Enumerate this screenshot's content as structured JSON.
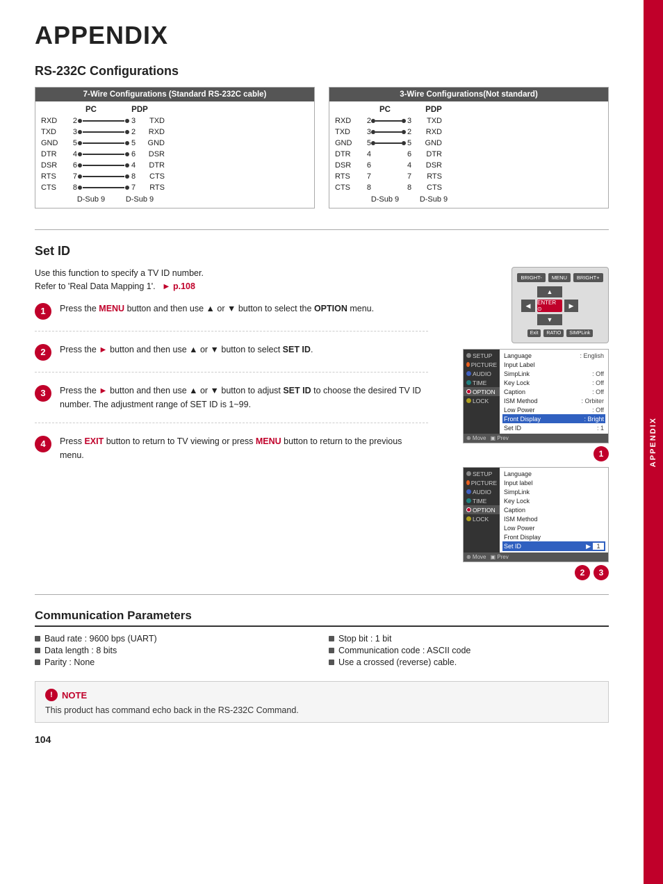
{
  "page": {
    "title": "APPENDIX",
    "number": "104",
    "sidebar_label": "APPENDIX"
  },
  "rs232c": {
    "heading": "RS-232C Configurations",
    "seven_wire": {
      "header": "7-Wire Configurations (Standard RS-232C cable)",
      "pc_label": "PC",
      "pdp_label": "PDP",
      "rows": [
        {
          "left": "RXD",
          "pc": "2",
          "pdp": "3",
          "right": "TXD",
          "connected": true
        },
        {
          "left": "TXD",
          "pc": "3",
          "pdp": "2",
          "right": "RXD",
          "connected": true
        },
        {
          "left": "GND",
          "pc": "5",
          "pdp": "5",
          "right": "GND",
          "connected": true
        },
        {
          "left": "DTR",
          "pc": "4",
          "pdp": "6",
          "right": "DSR",
          "connected": true
        },
        {
          "left": "DSR",
          "pc": "6",
          "pdp": "4",
          "right": "DTR",
          "connected": true
        },
        {
          "left": "RTS",
          "pc": "7",
          "pdp": "8",
          "right": "CTS",
          "connected": true
        },
        {
          "left": "CTS",
          "pc": "8",
          "pdp": "7",
          "right": "RTS",
          "connected": true
        }
      ],
      "dsub_pc": "D-Sub 9",
      "dsub_pdp": "D-Sub 9"
    },
    "three_wire": {
      "header": "3-Wire Configurations(Not standard)",
      "pc_label": "PC",
      "pdp_label": "PDP",
      "rows": [
        {
          "left": "RXD",
          "pc": "2",
          "pdp": "3",
          "right": "TXD",
          "connected": true
        },
        {
          "left": "TXD",
          "pc": "3",
          "pdp": "2",
          "right": "RXD",
          "connected": true
        },
        {
          "left": "GND",
          "pc": "5",
          "pdp": "5",
          "right": "GND",
          "connected": true
        },
        {
          "left": "DTR",
          "pc": "4",
          "pdp": "6",
          "right": "DTR",
          "connected": false
        },
        {
          "left": "DSR",
          "pc": "6",
          "pdp": "4",
          "right": "DSR",
          "connected": false
        },
        {
          "left": "RTS",
          "pc": "7",
          "pdp": "7",
          "right": "RTS",
          "connected": false
        },
        {
          "left": "CTS",
          "pc": "8",
          "pdp": "8",
          "right": "CTS",
          "connected": false
        }
      ],
      "dsub_pc": "D-Sub 9",
      "dsub_pdp": "D-Sub 9"
    }
  },
  "set_id": {
    "heading": "Set ID",
    "intro1": "Use this function to specify a TV ID number.",
    "intro2": "Refer to 'Real Data Mapping 1'.",
    "page_ref": "p.108",
    "steps": [
      {
        "num": "1",
        "text_parts": [
          "Press the ",
          "MENU",
          " button and then use ▲ or ▼ button to select the ",
          "OPTION",
          " menu."
        ]
      },
      {
        "num": "2",
        "text_parts": [
          "Press the ",
          "▶",
          " button and then use ▲ or ▼ button to select ",
          "SET ID",
          "."
        ]
      },
      {
        "num": "3",
        "text_parts": [
          "Press the ",
          "▶",
          " button and then use ▲ or ▼ button to adjust ",
          "SET ID",
          " to choose the desired TV ID number. The adjustment range of SET ID is 1~99."
        ]
      },
      {
        "num": "4",
        "text_parts": [
          "Press ",
          "EXIT",
          " button to return to TV viewing or press ",
          "MENU",
          " button to return to the previous menu."
        ]
      }
    ],
    "menu1": {
      "sidebar_items": [
        "SETUP",
        "PICTURE",
        "AUDIO",
        "TIME",
        "OPTION",
        "LOCK"
      ],
      "active_item": "OPTION",
      "rows": [
        {
          "label": "Language",
          "value": ": English"
        },
        {
          "label": "Input Label",
          "value": ""
        },
        {
          "label": "SimpLink",
          "value": ": Off"
        },
        {
          "label": "Key Lock",
          "value": ": Off"
        },
        {
          "label": "Caption",
          "value": ": Off"
        },
        {
          "label": "ISM Method",
          "value": ": Orbiter"
        },
        {
          "label": "Low Power",
          "value": ": Off"
        },
        {
          "label": "Front Display",
          "value": ": Bright"
        },
        {
          "label": "Set ID",
          "value": ": 1"
        }
      ],
      "footer": "Move  Prev"
    },
    "menu2": {
      "sidebar_items": [
        "SETUP",
        "PICTURE",
        "AUDIO",
        "TIME",
        "OPTION",
        "LOCK"
      ],
      "active_item": "OPTION",
      "rows": [
        {
          "label": "Language",
          "value": ""
        },
        {
          "label": "Input label",
          "value": ""
        },
        {
          "label": "SimpLink",
          "value": ""
        },
        {
          "label": "Key Lock",
          "value": ""
        },
        {
          "label": "Caption",
          "value": ""
        },
        {
          "label": "ISM Method",
          "value": ""
        },
        {
          "label": "Low Power",
          "value": ""
        },
        {
          "label": "Front Display",
          "value": ""
        },
        {
          "label": "Set ID",
          "value": "▶",
          "has_box": true
        }
      ],
      "footer": "Move  Prev",
      "badge": "1"
    }
  },
  "comm_params": {
    "heading": "Communication Parameters",
    "items_left": [
      "Baud rate : 9600 bps (UART)",
      "Data length : 8 bits",
      "Parity : None"
    ],
    "items_right": [
      "Stop bit : 1 bit",
      "Communication code : ASCII code",
      "Use a crossed (reverse) cable."
    ]
  },
  "note": {
    "label": "NOTE",
    "text": "This product has command echo back in the RS-232C Command."
  }
}
